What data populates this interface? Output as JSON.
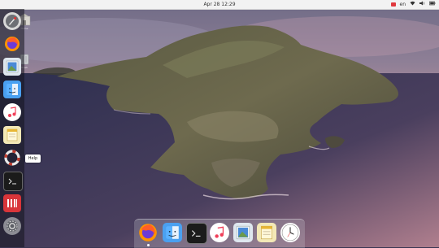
{
  "topbar": {
    "clock": "Apr 28  12:29",
    "language": "en",
    "apple_glyph": "",
    "status_icons": [
      "network-icon",
      "volume-icon",
      "battery-icon"
    ],
    "indicator_color": "#e0393e"
  },
  "desktop": {
    "icons": [
      {
        "name": "home-folder",
        "label": "Home"
      },
      {
        "name": "trash",
        "label": "Trash"
      }
    ],
    "wallpaper": "macOS Catalina island"
  },
  "sidebar_dock": {
    "items": [
      {
        "name": "launchpad-icon"
      },
      {
        "name": "firefox-icon"
      },
      {
        "name": "photo-viewer-icon"
      },
      {
        "name": "finder-icon"
      },
      {
        "name": "music-icon"
      },
      {
        "name": "notes-icon"
      },
      {
        "name": "help-icon"
      },
      {
        "name": "terminal-icon"
      },
      {
        "name": "app-indicator-icon"
      },
      {
        "name": "settings-icon"
      }
    ],
    "tooltip": "Help"
  },
  "bottom_dock": {
    "items": [
      {
        "name": "firefox-icon"
      },
      {
        "name": "finder-icon"
      },
      {
        "name": "terminal-icon"
      },
      {
        "name": "music-icon"
      },
      {
        "name": "photo-viewer-icon"
      },
      {
        "name": "notes-icon"
      },
      {
        "name": "clock-icon"
      }
    ]
  }
}
